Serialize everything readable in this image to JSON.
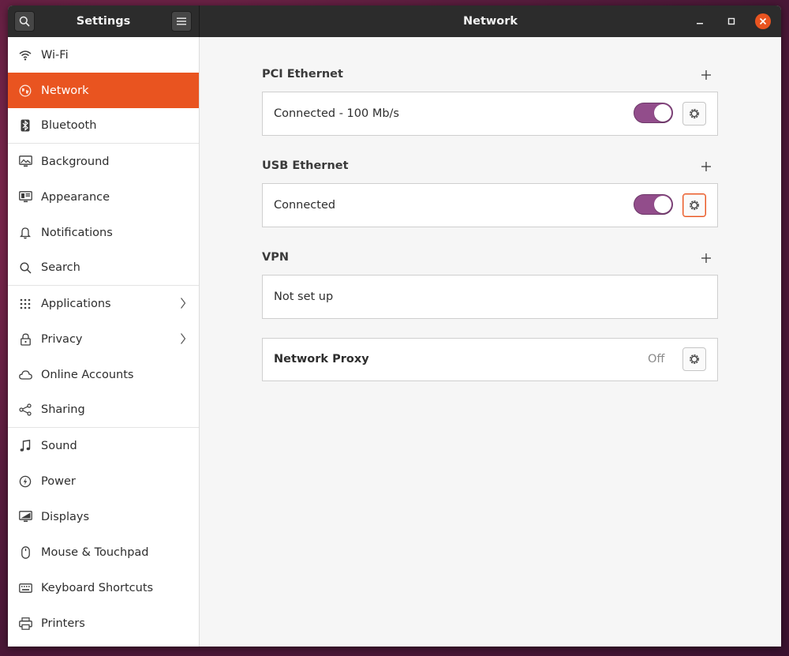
{
  "header": {
    "app_title": "Settings",
    "page_title": "Network"
  },
  "sidebar": {
    "items": [
      {
        "label": "Wi-Fi",
        "icon": "wifi-icon"
      },
      {
        "label": "Network",
        "icon": "network-globe-icon",
        "selected": true
      },
      {
        "label": "Bluetooth",
        "icon": "bluetooth-icon"
      },
      {
        "label": "Background",
        "icon": "background-icon"
      },
      {
        "label": "Appearance",
        "icon": "appearance-icon"
      },
      {
        "label": "Notifications",
        "icon": "bell-icon"
      },
      {
        "label": "Search",
        "icon": "search-icon"
      },
      {
        "label": "Applications",
        "icon": "apps-grid-icon",
        "has_submenu": true
      },
      {
        "label": "Privacy",
        "icon": "lock-icon",
        "has_submenu": true
      },
      {
        "label": "Online Accounts",
        "icon": "cloud-icon"
      },
      {
        "label": "Sharing",
        "icon": "share-icon"
      },
      {
        "label": "Sound",
        "icon": "music-note-icon"
      },
      {
        "label": "Power",
        "icon": "power-icon"
      },
      {
        "label": "Displays",
        "icon": "display-icon"
      },
      {
        "label": "Mouse & Touchpad",
        "icon": "mouse-icon"
      },
      {
        "label": "Keyboard Shortcuts",
        "icon": "keyboard-icon"
      },
      {
        "label": "Printers",
        "icon": "printer-icon"
      }
    ]
  },
  "main": {
    "pci_ethernet": {
      "title": "PCI Ethernet",
      "status": "Connected - 100 Mb/s",
      "enabled": true
    },
    "usb_ethernet": {
      "title": "USB Ethernet",
      "status": "Connected",
      "enabled": true
    },
    "vpn": {
      "title": "VPN",
      "status": "Not set up"
    },
    "proxy": {
      "label": "Network Proxy",
      "value": "Off"
    }
  },
  "colors": {
    "accent": "#e95420",
    "toggle_on": "#924d8b",
    "headerbar": "#2c2c2c"
  }
}
